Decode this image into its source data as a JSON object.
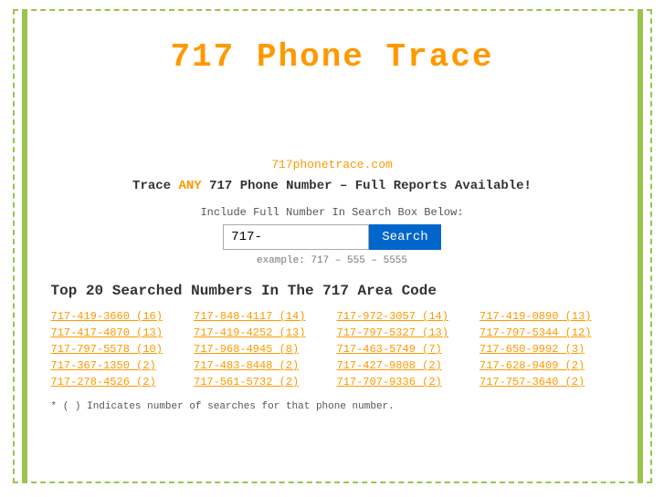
{
  "title": "717 Phone Trace",
  "site_url": "717phonetrace.com",
  "tagline_prefix": "Trace ",
  "tagline_any": "ANY",
  "tagline_suffix": " 717 Phone Number – Full Reports Available!",
  "search_label": "Include Full Number In Search Box Below:",
  "search_input_value": "717-",
  "search_button_label": "Search",
  "example_text": "example: 717 – 555 – 5555",
  "top20_title": "Top 20 Searched Numbers In The 717 Area Code",
  "numbers": [
    "717-419-3660 (16)",
    "717-848-4117 (14)",
    "717-972-3057 (14)",
    "717-419-0890 (13)",
    "717-417-4870 (13)",
    "717-419-4252 (13)",
    "717-797-5327 (13)",
    "717-797-5344 (12)",
    "717-797-5578 (10)",
    "717-968-4945 (8)",
    "717-463-5749 (7)",
    "717-650-9992 (3)",
    "717-367-1350 (2)",
    "717-483-8448 (2)",
    "717-427-9808 (2)",
    "717-628-9409 (2)",
    "717-278-4526 (2)",
    "717-561-5732 (2)",
    "717-707-9336 (2)",
    "717-757-3640 (2)"
  ],
  "footnote": "* ( ) Indicates number of searches for that phone number."
}
